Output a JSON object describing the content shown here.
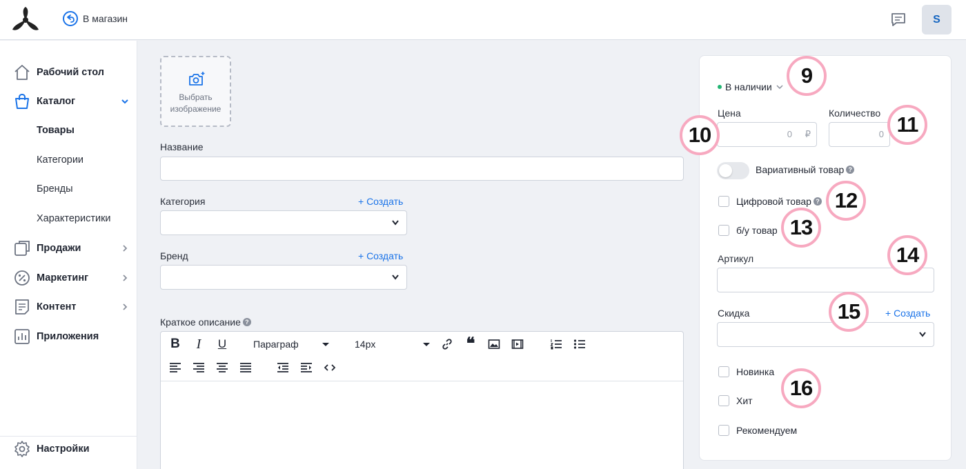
{
  "header": {
    "back_label": "В магазин",
    "avatar_letter": "S"
  },
  "sidebar": {
    "items": [
      {
        "label": "Рабочий стол",
        "icon": "home-icon"
      },
      {
        "label": "Каталог",
        "icon": "shopping-bag-icon",
        "expanded": true
      },
      {
        "label": "Продажи",
        "icon": "sales-icon"
      },
      {
        "label": "Маркетинг",
        "icon": "percent-icon"
      },
      {
        "label": "Контент",
        "icon": "document-icon"
      },
      {
        "label": "Приложения",
        "icon": "chart-icon"
      }
    ],
    "catalog_subitems": [
      "Товары",
      "Категории",
      "Бренды",
      "Характеристики"
    ],
    "settings_label": "Настройки"
  },
  "form": {
    "image_picker_label": "Выбрать изображение",
    "name_label": "Название",
    "category_label": "Категория",
    "brand_label": "Бренд",
    "create_link": "+ Создать",
    "short_description_label": "Краткое описание"
  },
  "editor": {
    "paragraph_select": "Параграф",
    "font_size_select": "14px"
  },
  "sidebar_form": {
    "stock_status": "В наличии",
    "price_label": "Цена",
    "price_value": "0",
    "currency": "₽",
    "quantity_label": "Количество",
    "quantity_value": "0",
    "variant_label": "Вариативный товар",
    "digital_label": "Цифровой товар",
    "used_label": "б/у товар",
    "sku_label": "Артикул",
    "discount_label": "Скидка",
    "discount_create": "+ Создать",
    "flags": [
      "Новинка",
      "Хит",
      "Рекомендуем"
    ]
  },
  "badges": [
    "9",
    "10",
    "11",
    "12",
    "13",
    "14",
    "15",
    "16"
  ],
  "colors": {
    "accent": "#1a73e8",
    "in_stock": "#22b573",
    "badge_ring": "#f7a9c0"
  }
}
